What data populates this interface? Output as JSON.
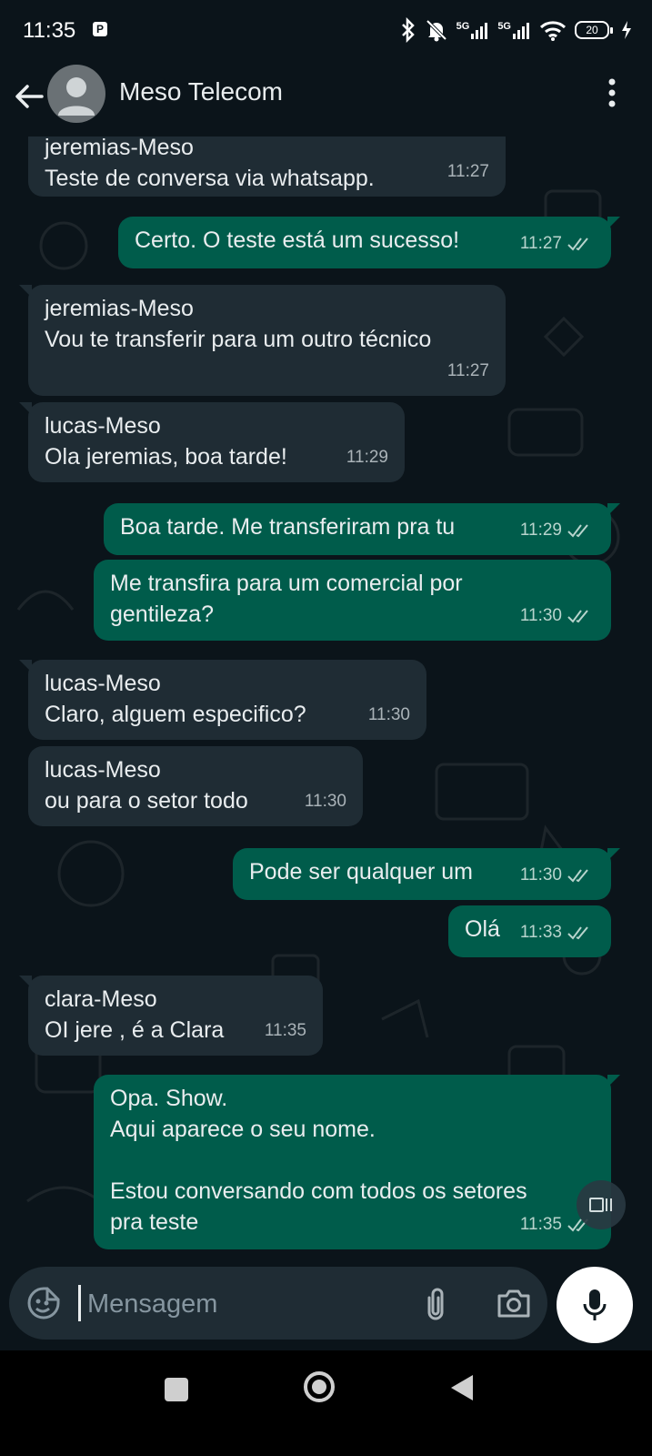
{
  "status_bar": {
    "time": "11:35",
    "notification_badge": "P",
    "network_1": "5G",
    "network_2": "5G",
    "battery": "20"
  },
  "header": {
    "contact_name": "Meso Telecom"
  },
  "messages": [
    {
      "direction": "in",
      "sender": "jeremias-Meso",
      "lines": [
        "Teste de conversa via whatsapp."
      ],
      "time": "11:27"
    },
    {
      "direction": "out",
      "lines": [
        "Certo. O teste está um sucesso!"
      ],
      "time": "11:27"
    },
    {
      "direction": "in",
      "sender": "jeremias-Meso",
      "lines": [
        "Vou te transferir para um outro técnico"
      ],
      "time": "11:27"
    },
    {
      "direction": "in",
      "sender": "lucas-Meso",
      "lines": [
        "Ola jeremias, boa tarde!"
      ],
      "time": "11:29"
    },
    {
      "direction": "out",
      "lines": [
        "Boa tarde. Me transferiram pra tu"
      ],
      "time": "11:29"
    },
    {
      "direction": "out",
      "lines": [
        "Me transfira para um comercial por",
        "gentileza?"
      ],
      "time": "11:30"
    },
    {
      "direction": "in",
      "sender": "lucas-Meso",
      "lines": [
        "Claro, alguem especifico?"
      ],
      "time": "11:30"
    },
    {
      "direction": "in",
      "sender": "lucas-Meso",
      "lines": [
        "ou para o setor todo"
      ],
      "time": "11:30"
    },
    {
      "direction": "out",
      "lines": [
        "Pode ser qualquer um"
      ],
      "time": "11:30"
    },
    {
      "direction": "out",
      "lines": [
        "Olá"
      ],
      "time": "11:33"
    },
    {
      "direction": "in",
      "sender": "clara-Meso",
      "lines": [
        "OI jere , é a Clara"
      ],
      "time": "11:35"
    },
    {
      "direction": "out",
      "lines": [
        "Opa. Show.",
        "Aqui aparece o seu nome.",
        "",
        "Estou conversando com todos os setores",
        "pra teste"
      ],
      "time": "11:35"
    }
  ],
  "composer": {
    "placeholder": "Mensagem"
  }
}
